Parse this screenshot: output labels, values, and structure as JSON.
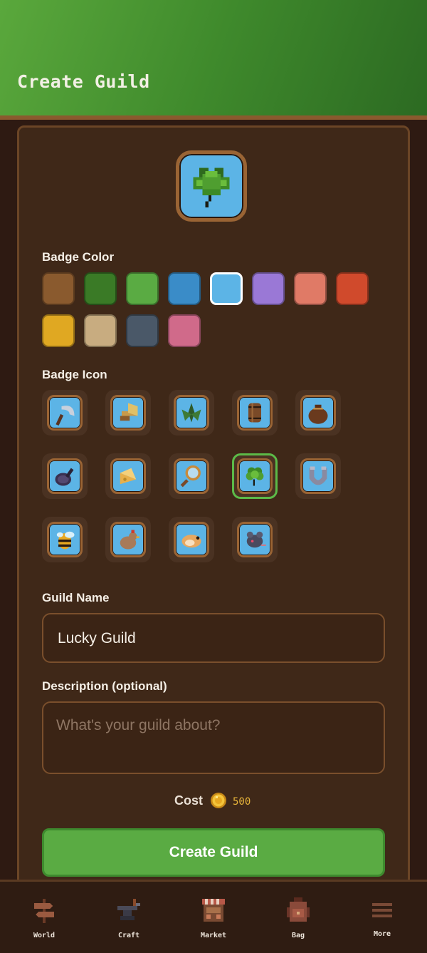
{
  "header": {
    "title": "Create Guild"
  },
  "preview": {
    "icon": "clover-icon",
    "color": "#5cb4e6"
  },
  "badge_color": {
    "label": "Badge Color",
    "selected_index": 4,
    "colors": [
      "#8a5a2e",
      "#3a7a26",
      "#5aab43",
      "#3a8cc8",
      "#5cb4e6",
      "#9a78d6",
      "#e07a66",
      "#d04a2c",
      "#e0a822",
      "#c8ac80",
      "#4a5868",
      "#d06a8a"
    ]
  },
  "badge_icon": {
    "label": "Badge Icon",
    "selected_index": 8,
    "icons": [
      "sickle-icon",
      "axe-icon",
      "herb-icon",
      "barrel-icon",
      "sack-icon",
      "frying-pan-icon",
      "cheese-icon",
      "magnifier-icon",
      "clover-icon",
      "horseshoe-icon",
      "bee-icon",
      "chicken-icon",
      "hamster-icon",
      "rat-icon"
    ]
  },
  "guild_name": {
    "label": "Guild Name",
    "value": "Lucky Guild"
  },
  "description": {
    "label": "Description (optional)",
    "placeholder": "What's your guild about?"
  },
  "cost": {
    "label": "Cost",
    "value": "500",
    "icon": "coin-icon"
  },
  "create_button": {
    "label": "Create Guild"
  },
  "nav": [
    {
      "label": "World",
      "icon": "signpost-icon"
    },
    {
      "label": "Craft",
      "icon": "anvil-icon"
    },
    {
      "label": "Market",
      "icon": "market-stall-icon"
    },
    {
      "label": "Bag",
      "icon": "backpack-icon"
    },
    {
      "label": "More",
      "icon": "menu-icon"
    }
  ],
  "colors": {
    "header_green": "#4f9a36",
    "panel_brown": "#3f2818",
    "accent_green": "#5aab43",
    "coin_gold": "#e8b53a"
  }
}
